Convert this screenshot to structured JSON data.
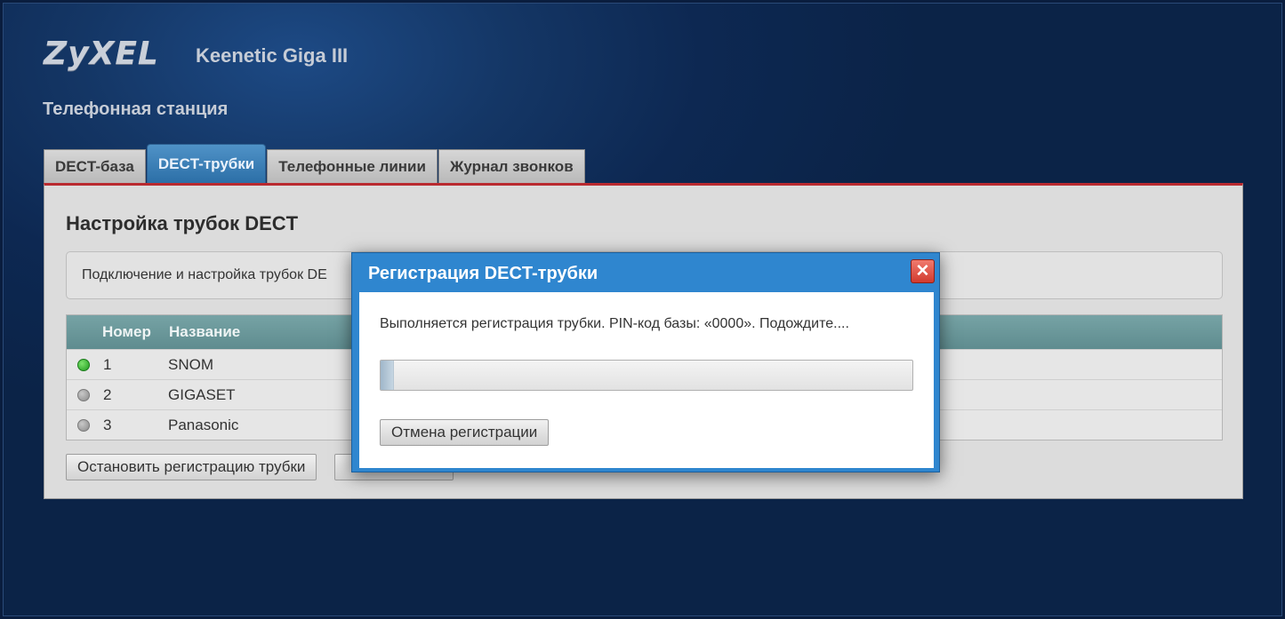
{
  "header": {
    "logo_text": "ZyXEL",
    "model": "Keenetic Giga III",
    "section_title": "Телефонная станция"
  },
  "tabs": [
    {
      "label": "DECT-база",
      "active": false
    },
    {
      "label": "DECT-трубки",
      "active": true
    },
    {
      "label": "Телефонные линии",
      "active": false
    },
    {
      "label": "Журнал звонков",
      "active": false
    }
  ],
  "panel": {
    "heading": "Настройка трубок DECT",
    "info_text": "Подключение и настройка трубок DE"
  },
  "table": {
    "columns": [
      "Номер",
      "Название"
    ],
    "rows": [
      {
        "num": "1",
        "name": "SNOM",
        "status": "active"
      },
      {
        "num": "2",
        "name": "GIGASET",
        "status": "inactive"
      },
      {
        "num": "3",
        "name": "Panasonic",
        "status": "inactive"
      }
    ]
  },
  "buttons": {
    "stop_registration": "Остановить регистрацию трубки"
  },
  "dialog": {
    "title": "Регистрация DECT-трубки",
    "close_symbol": "✕",
    "message": "Выполняется регистрация трубки. PIN-код базы: «0000». Подождите....",
    "progress_fraction": 0.025,
    "cancel_label": "Отмена регистрации"
  },
  "colors": {
    "active_tab": "#2c6fa7",
    "accent_bar": "#b92a30",
    "dialog_frame": "#2f86cf",
    "status_on": "#1f9a1f",
    "status_off": "#8a8a8a"
  }
}
